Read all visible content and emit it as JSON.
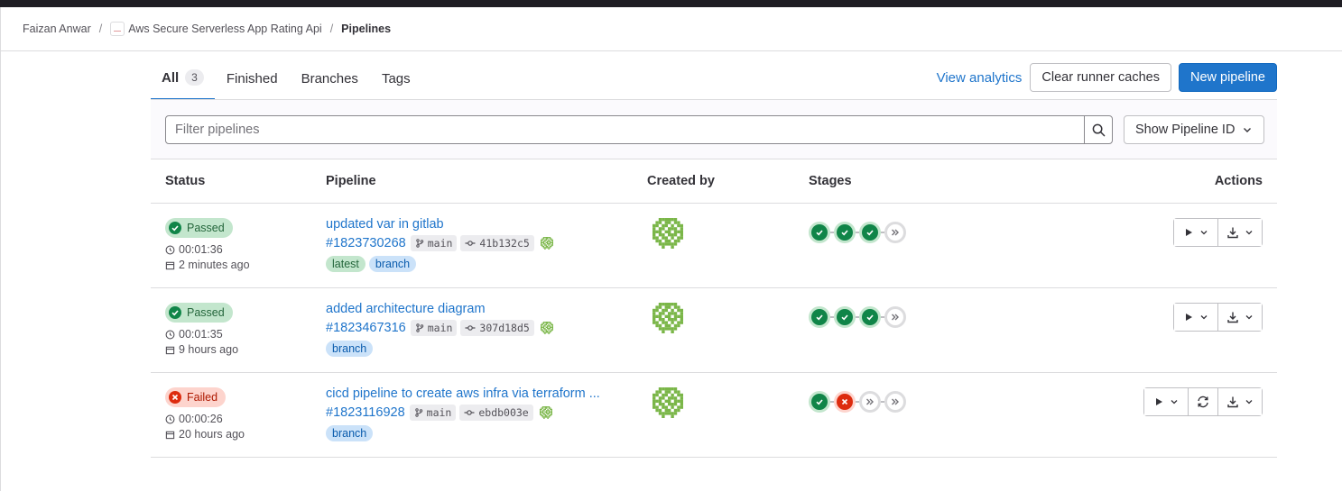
{
  "breadcrumb": [
    "Faizan Anwar",
    "Aws Secure Serverless App Rating Api",
    "Pipelines"
  ],
  "tabs": [
    {
      "label": "All",
      "count": "3"
    },
    {
      "label": "Finished"
    },
    {
      "label": "Branches"
    },
    {
      "label": "Tags"
    }
  ],
  "header_actions": {
    "analytics": "View analytics",
    "clear": "Clear runner caches",
    "new": "New pipeline"
  },
  "filter": {
    "placeholder": "Filter pipelines",
    "show_id": "Show Pipeline ID"
  },
  "columns": {
    "status": "Status",
    "pipeline": "Pipeline",
    "created_by": "Created by",
    "stages": "Stages",
    "actions": "Actions"
  },
  "pipelines": [
    {
      "status": "Passed",
      "duration": "00:01:36",
      "finished": "2 minutes ago",
      "title": "updated var in gitlab",
      "id": "#1823730268",
      "ref": "main",
      "sha": "41b132c5",
      "tags": [
        "latest",
        "branch"
      ],
      "stages": [
        "success",
        "success",
        "success",
        "skipped"
      ],
      "retry": false
    },
    {
      "status": "Passed",
      "duration": "00:01:35",
      "finished": "9 hours ago",
      "title": "added architecture diagram",
      "id": "#1823467316",
      "ref": "main",
      "sha": "307d18d5",
      "tags": [
        "branch"
      ],
      "stages": [
        "success",
        "success",
        "success",
        "skipped"
      ],
      "retry": false
    },
    {
      "status": "Failed",
      "duration": "00:00:26",
      "finished": "20 hours ago",
      "title": "cicd pipeline to create aws infra via terraform ...",
      "id": "#1823116928",
      "ref": "main",
      "sha": "ebdb003e",
      "tags": [
        "branch"
      ],
      "stages": [
        "success",
        "failed",
        "skipped",
        "skipped"
      ],
      "retry": true
    }
  ],
  "colors": {
    "accent": "#1f75cb",
    "success": "#108548",
    "failed": "#dd2b0e"
  }
}
